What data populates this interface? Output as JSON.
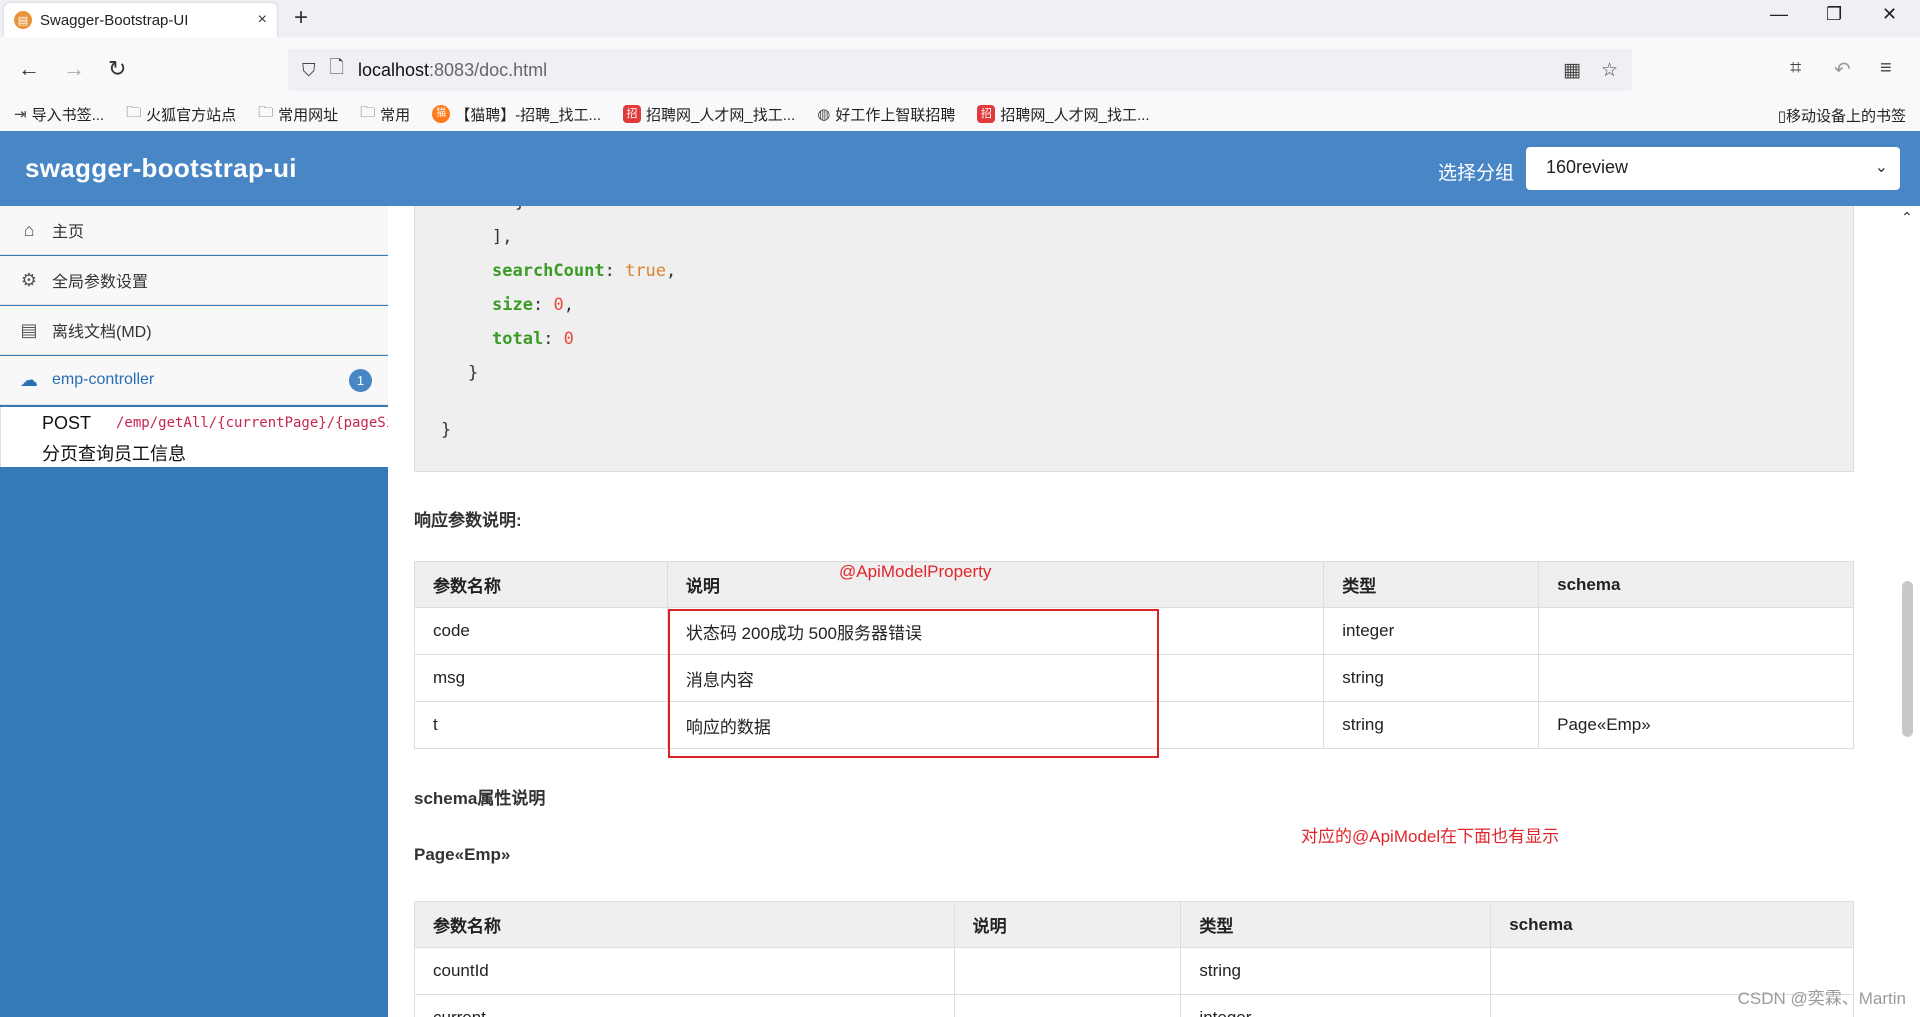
{
  "browser": {
    "tab_title": "Swagger-Bootstrap-UI",
    "tab_close": "×",
    "new_tab": "+",
    "url_host": "localhost",
    "url_rest": ":8083/doc.html",
    "window_minimize": "—",
    "window_restore": "❐",
    "window_close": "✕"
  },
  "bookmarks": {
    "items": [
      {
        "icon": "import-icon",
        "label": "导入书签..."
      },
      {
        "icon": "folder-icon",
        "label": "火狐官方站点"
      },
      {
        "icon": "folder-icon",
        "label": "常用网址"
      },
      {
        "icon": "folder-icon",
        "label": "常用"
      },
      {
        "icon": "maopin-icon",
        "label": "【猫聘】-招聘_找工..."
      },
      {
        "icon": "zhaopin-icon",
        "label": "招聘网_人才网_找工..."
      },
      {
        "icon": "globe-icon",
        "label": "好工作上智联招聘"
      },
      {
        "icon": "zhaopin-icon",
        "label": "招聘网_人才网_找工..."
      }
    ],
    "mobile": "移动设备上的书签"
  },
  "header": {
    "title": "swagger-bootstrap-ui",
    "group_label": "选择分组",
    "group_selected": "160review"
  },
  "sidebar": {
    "items": [
      {
        "label": "主页",
        "icon": "home-icon"
      },
      {
        "label": "全局参数设置",
        "icon": "settings-doc-icon"
      },
      {
        "label": "离线文档(MD)",
        "icon": "document-icon"
      },
      {
        "label": "emp-controller",
        "icon": "cloud-api-icon",
        "badge": "1"
      }
    ],
    "api": {
      "method": "POST",
      "path": "/emp/getAll/{currentPage}/{pageSize}",
      "desc": "分页查询员工信息"
    }
  },
  "code": {
    "l1": "}",
    "l2": "],",
    "k_searchCount": "searchCount",
    "v_searchCount": "true",
    "k_size": "size",
    "v_size": "0",
    "k_total": "total",
    "v_total": "0",
    "l6": "}",
    "l7": "}"
  },
  "response_params": {
    "label": "响应参数说明",
    "headers": [
      "参数名称",
      "说明",
      "类型",
      "schema"
    ],
    "rows": [
      [
        "code",
        "状态码 200成功 500服务器错误",
        "integer",
        ""
      ],
      [
        "msg",
        "消息内容",
        "string",
        ""
      ],
      [
        "t",
        "响应的数据",
        "string",
        "Page«Emp»"
      ]
    ]
  },
  "schema": {
    "label": "schema属性说明",
    "name": "Page«Emp»",
    "headers": [
      "参数名称",
      "说明",
      "类型",
      "schema"
    ],
    "rows": [
      [
        "countId",
        "",
        "string",
        ""
      ],
      [
        "current",
        "",
        "integer",
        ""
      ]
    ]
  },
  "annotations": {
    "apimodelproperty": "@ApiModelProperty",
    "apimodel": "对应的@ApiModel在下面也有显示"
  },
  "watermark": "CSDN @奕霖、Martin",
  "colors": {
    "header": "#4886c6",
    "sidebar": "#337ab7",
    "annotation": "#e0262b",
    "json_key": "#3a9b25",
    "json_bool": "#d9822b",
    "json_number": "#e84c3d",
    "path": "#c7254e"
  }
}
